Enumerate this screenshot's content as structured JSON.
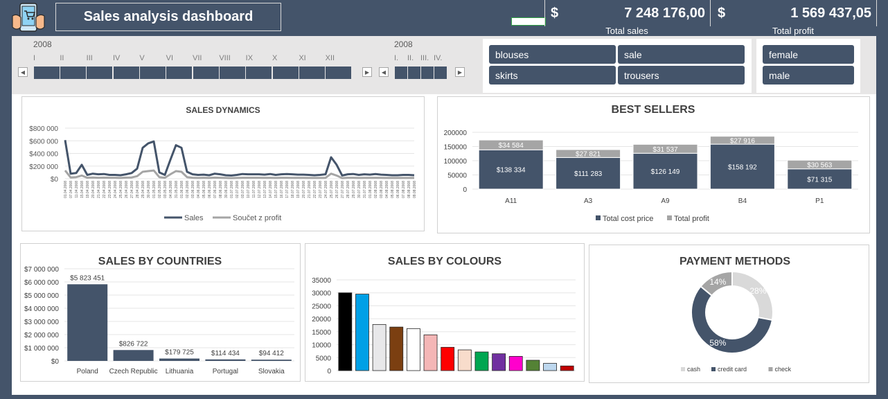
{
  "header": {
    "title": "Sales analysis dashboard",
    "currency_symbol": "$",
    "total_sales_value": "7 248 176,00",
    "total_sales_label": "Total sales",
    "total_profit_value": "1 569 437,05",
    "total_profit_label": "Total profit"
  },
  "timeline_months": {
    "year": "2008",
    "months": [
      "I",
      "II",
      "III",
      "IV",
      "V",
      "VI",
      "VII",
      "VIII",
      "IX",
      "X",
      "XI",
      "XII"
    ]
  },
  "timeline_quarters": {
    "year": "2008",
    "quarters": [
      "I.",
      "II.",
      "III.",
      "IV."
    ]
  },
  "slicer_products": [
    "blouses",
    "sale",
    "skirts",
    "trousers"
  ],
  "slicer_gender": [
    "female",
    "male"
  ],
  "colors": {
    "navy": "#44546a",
    "gray": "#a5a5a5",
    "light_gray": "#c9c9c9"
  },
  "chart_data": [
    {
      "id": "sales_dynamics",
      "type": "line",
      "title": "SALES DYNAMICS",
      "y_ticks": [
        "$800 000",
        "$600 000",
        "$400 000",
        "$200 000",
        "$0"
      ],
      "ylim": [
        0,
        800000
      ],
      "x_dates": [
        "01.04.2008",
        "07.04.2008",
        "11.04.2008",
        "15.04.2008",
        "19.04.2008",
        "20.04.2008",
        "21.04.2008",
        "22.04.2008",
        "23.04.2008",
        "24.04.2008",
        "25.04.2008",
        "26.04.2008",
        "27.04.2008",
        "28.04.2008",
        "29.04.2008",
        "30.04.2008",
        "01.05.2008",
        "02.05.2008",
        "03.05.2008",
        "04.05.2008",
        "31.05.2008",
        "01.06.2008",
        "02.06.2008",
        "03.06.2008",
        "04.06.2008",
        "05.06.2008",
        "06.06.2008",
        "07.06.2008",
        "08.06.2008",
        "30.06.2008",
        "01.07.2008",
        "02.07.2008",
        "03.07.2008",
        "10.07.2008",
        "11.07.2008",
        "12.07.2008",
        "13.07.2008",
        "14.07.2008",
        "15.07.2008",
        "16.07.2008",
        "17.07.2008",
        "18.07.2008",
        "19.07.2008",
        "20.07.2008",
        "21.07.2008",
        "22.07.2008",
        "23.07.2008",
        "24.07.2008",
        "25.07.2008",
        "26.07.2008",
        "27.07.2008",
        "28.07.2008",
        "29.07.2008",
        "30.07.2008",
        "31.07.2008",
        "01.08.2008",
        "02.08.2008",
        "03.08.2008",
        "04.08.2008",
        "05.08.2008",
        "06.08.2008",
        "07.08.2008",
        "08.08.2008",
        "09.08.2008"
      ],
      "series": [
        {
          "name": "Sales",
          "color": "#44546a",
          "values": [
            610000,
            80000,
            90000,
            220000,
            60000,
            80000,
            70000,
            75000,
            60000,
            60000,
            55000,
            70000,
            90000,
            160000,
            490000,
            560000,
            590000,
            100000,
            60000,
            300000,
            530000,
            490000,
            110000,
            70000,
            60000,
            65000,
            55000,
            80000,
            70000,
            55000,
            50000,
            60000,
            75000,
            70000,
            70000,
            70000,
            65000,
            75000,
            60000,
            70000,
            75000,
            70000,
            65000,
            65000,
            60000,
            55000,
            60000,
            70000,
            340000,
            220000,
            50000,
            70000,
            75000,
            60000,
            70000,
            65000,
            75000,
            65000,
            60000,
            55000,
            55000,
            60000,
            60000,
            55000
          ]
        },
        {
          "name": "Součet z profit",
          "color": "#a5a5a5",
          "values": [
            130000,
            20000,
            25000,
            50000,
            15000,
            20000,
            15000,
            18000,
            15000,
            15000,
            12000,
            18000,
            20000,
            40000,
            110000,
            120000,
            130000,
            25000,
            15000,
            70000,
            120000,
            110000,
            25000,
            15000,
            12000,
            15000,
            12000,
            18000,
            15000,
            12000,
            10000,
            12000,
            15000,
            15000,
            15000,
            15000,
            14000,
            15000,
            12000,
            15000,
            15000,
            14000,
            14000,
            14000,
            12000,
            12000,
            12000,
            14000,
            80000,
            50000,
            10000,
            15000,
            15000,
            12000,
            14000,
            14000,
            15000,
            14000,
            12000,
            12000,
            12000,
            12000,
            12000,
            12000
          ]
        }
      ]
    },
    {
      "id": "best_sellers",
      "type": "bar",
      "title": "BEST SELLERS",
      "categories": [
        "A11",
        "A3",
        "A9",
        "B4",
        "P1"
      ],
      "y_ticks": [
        "200000",
        "150000",
        "100000",
        "50000",
        "0"
      ],
      "ylim": [
        0,
        200000
      ],
      "series": [
        {
          "name": "Total cost price",
          "color": "#44546a",
          "values": [
            138334,
            111283,
            126149,
            158192,
            71315
          ],
          "labels": [
            "$138 334",
            "$111 283",
            "$126 149",
            "$158 192",
            "$71 315"
          ]
        },
        {
          "name": "Total profit",
          "color": "#a5a5a5",
          "values": [
            34584,
            27821,
            31537,
            27916,
            30563
          ],
          "labels": [
            "$34 584",
            "$27 821",
            "$31 537",
            "$27 916",
            "$30 563"
          ]
        }
      ]
    },
    {
      "id": "sales_by_countries",
      "type": "bar",
      "title": "SALES BY COUNTRIES",
      "categories": [
        "Poland",
        "Czech Republic",
        "Lithuania",
        "Portugal",
        "Slovakia"
      ],
      "values": [
        5823451,
        826722,
        179725,
        114434,
        94412
      ],
      "labels": [
        "$5 823 451",
        "$826 722",
        "$179 725",
        "$114 434",
        "$94 412"
      ],
      "y_ticks": [
        "$7 000 000",
        "$6 000 000",
        "$5 000 000",
        "$4 000 000",
        "$3 000 000",
        "$2 000 000",
        "$1 000 000",
        "$0"
      ],
      "ylim": [
        0,
        7000000
      ]
    },
    {
      "id": "sales_by_colours",
      "type": "bar",
      "title": "SALES BY COLOURS",
      "values": [
        30000,
        29500,
        17800,
        16800,
        16200,
        13800,
        9000,
        8000,
        7200,
        6500,
        5500,
        4000,
        2800,
        1800
      ],
      "bar_colors": [
        "#000000",
        "#00a0e6",
        "#e8e8ea",
        "#7b3f11",
        "#ffffff",
        "#f4b6b6",
        "#ff0000",
        "#f8dccb",
        "#00a651",
        "#7030a0",
        "#ff00cc",
        "#548235",
        "#bdd7ee",
        "#c00000"
      ],
      "y_ticks": [
        "35000",
        "30000",
        "25000",
        "20000",
        "15000",
        "10000",
        "5000",
        "0"
      ],
      "ylim": [
        0,
        35000
      ]
    },
    {
      "id": "payment_methods",
      "type": "pie",
      "title": "PAYMENT METHODS",
      "slices": [
        {
          "name": "cash",
          "value": 28,
          "label": "28%",
          "color": "#d9d9d9"
        },
        {
          "name": "credit card",
          "value": 58,
          "label": "58%",
          "color": "#44546a"
        },
        {
          "name": "check",
          "value": 14,
          "label": "14%",
          "color": "#a5a5a5"
        }
      ]
    }
  ]
}
